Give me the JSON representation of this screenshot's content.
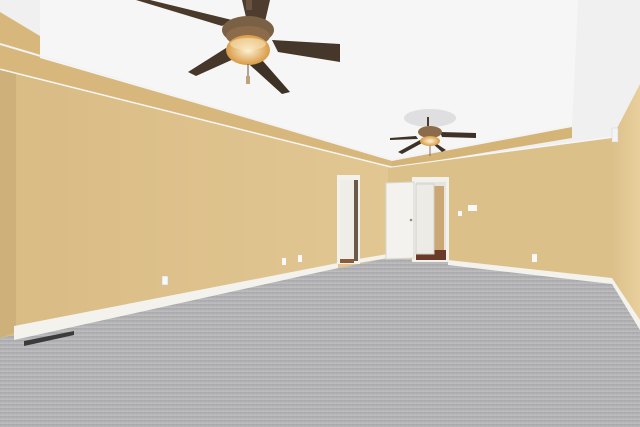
{
  "scene": {
    "description_kind": "empty-bedroom-photo",
    "colors": {
      "ceiling": "#f2f2f2",
      "tray_ceiling": "#f7f7f7",
      "wall_left": "#e0c48e",
      "wall_back": "#dcc08a",
      "wall_right": "#e3c892",
      "soffit": "#d9b97f",
      "carpet": "#b7b7b9",
      "baseboard": "#f4f1ea",
      "door": "#f2f0ea",
      "fan_blade": "#4a3a2c",
      "fan_light": "#e2b36a"
    }
  }
}
